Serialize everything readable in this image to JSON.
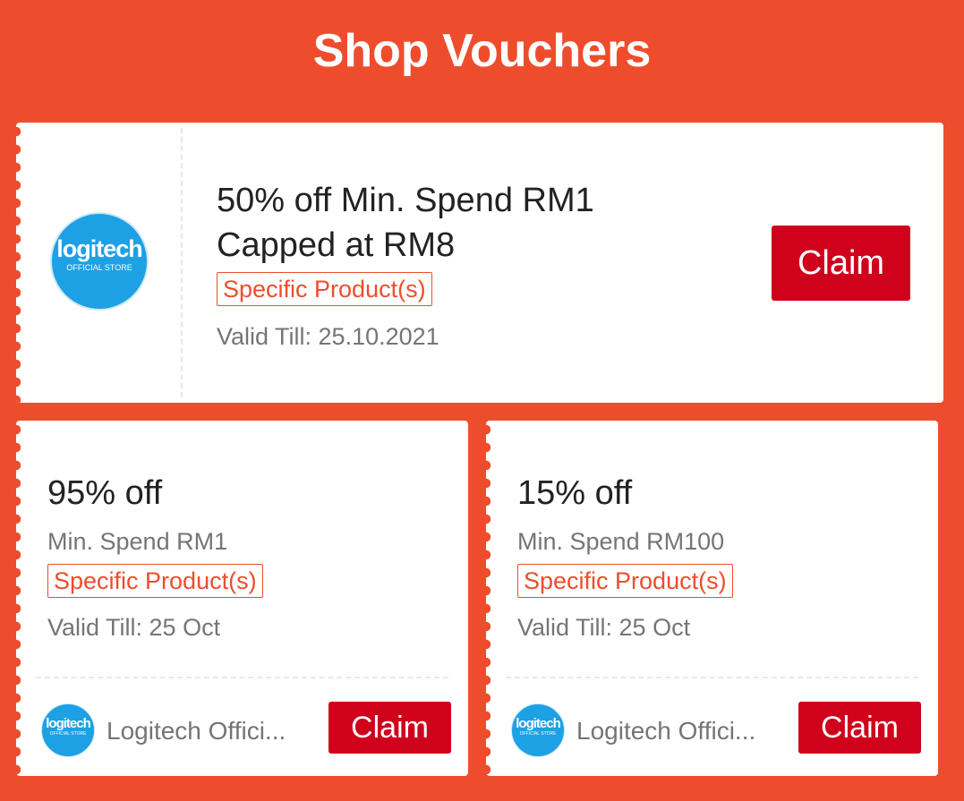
{
  "header": {
    "title": "Shop Vouchers"
  },
  "featured_voucher": {
    "logo": {
      "brand": "logitech",
      "subtitle": "OFFICIAL STORE"
    },
    "headline_line1": "50% off Min. Spend RM1",
    "headline_line2": "Capped at RM8",
    "tag": "Specific Product(s)",
    "valid": "Valid Till: 25.10.2021",
    "claim_label": "Claim"
  },
  "vouchers": [
    {
      "discount": "95% off",
      "min_spend": "Min. Spend RM1",
      "tag": "Specific Product(s)",
      "valid": "Valid Till: 25 Oct",
      "logo": {
        "brand": "logitech",
        "subtitle": "OFFICIAL STORE"
      },
      "shop_name": "Logitech Offici...",
      "claim_label": "Claim"
    },
    {
      "discount": "15% off",
      "min_spend": "Min. Spend RM100",
      "tag": "Specific Product(s)",
      "valid": "Valid Till: 25 Oct",
      "logo": {
        "brand": "logitech",
        "subtitle": "OFFICIAL STORE"
      },
      "shop_name": "Logitech Offici...",
      "claim_label": "Claim"
    }
  ],
  "colors": {
    "background": "#ee4d2d",
    "claim_button": "#d0011b",
    "tag": "#ee4d2d",
    "logo": "#1ea0e4"
  }
}
